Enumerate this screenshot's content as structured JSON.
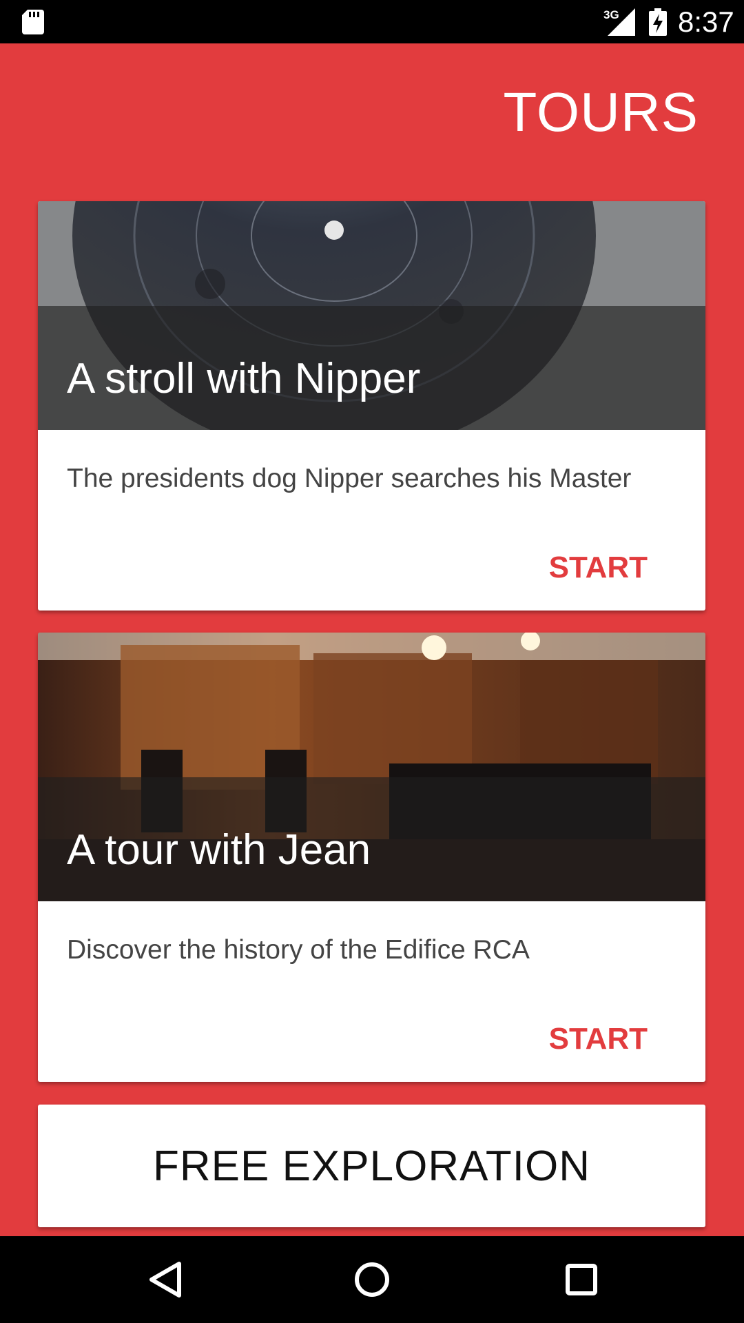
{
  "status_bar": {
    "time": "8:37",
    "network": "3G",
    "icons": [
      "sd-card-icon",
      "signal-icon",
      "battery-charging-icon"
    ]
  },
  "app": {
    "title": "TOURS"
  },
  "tours": [
    {
      "title": "A stroll with Nipper",
      "description": "The presidents dog Nipper searches his Master",
      "action": "START",
      "image": "record-disc-photo"
    },
    {
      "title": "A tour with Jean",
      "description": "Discover the history of the Edifice RCA",
      "action": "START",
      "image": "recording-studio-photo"
    }
  ],
  "free_exploration": {
    "label": "FREE EXPLORATION"
  },
  "nav_bar": {
    "icons": [
      "back-icon",
      "home-icon",
      "recents-icon"
    ]
  },
  "colors": {
    "accent": "#e23c3e",
    "card": "#ffffff",
    "bars": "#000000"
  }
}
